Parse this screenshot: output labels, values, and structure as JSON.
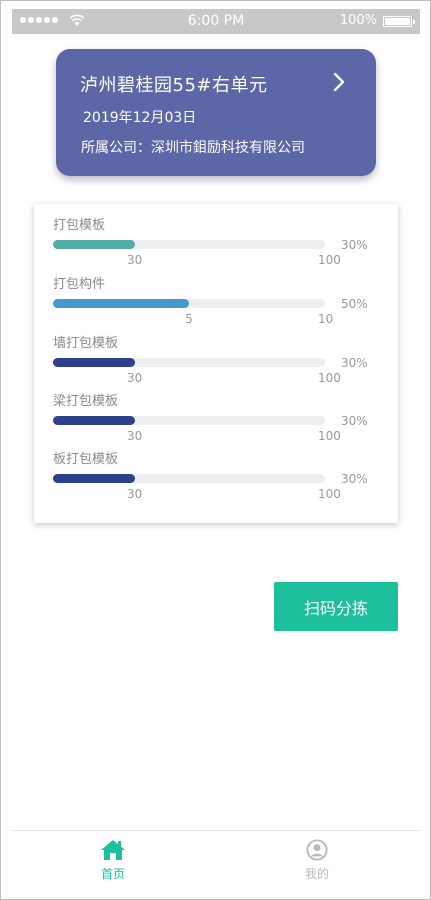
{
  "status_bar": {
    "time": "6:00 PM",
    "battery_percent": "100%"
  },
  "project": {
    "title": "泸州碧桂园55#右单元",
    "date": "2019年12月03日",
    "company": "所属公司：深圳市鉬励科技有限公司"
  },
  "progress_items": [
    {
      "label": "打包模板",
      "percent_text": "30%",
      "current": "30",
      "max": "100",
      "fraction": 0.3,
      "color": "#52ada8"
    },
    {
      "label": "打包构件",
      "percent_text": "50%",
      "current": "5",
      "max": "10",
      "fraction": 0.5,
      "color": "#4499cf"
    },
    {
      "label": "墙打包模板",
      "percent_text": "30%",
      "current": "30",
      "max": "100",
      "fraction": 0.3,
      "color": "#2e3f8c"
    },
    {
      "label": "梁打包模板",
      "percent_text": "30%",
      "current": "30",
      "max": "100",
      "fraction": 0.3,
      "color": "#2e3f8c"
    },
    {
      "label": "板打包模板",
      "percent_text": "30%",
      "current": "30",
      "max": "100",
      "fraction": 0.3,
      "color": "#2e3f8c"
    }
  ],
  "actions": {
    "scan_label": "扫码分拣"
  },
  "tabs": [
    {
      "label": "首页",
      "icon": "home-icon",
      "active": true
    },
    {
      "label": "我的",
      "icon": "user-icon",
      "active": false
    }
  ],
  "colors": {
    "accent": "#1ebf9d",
    "card": "#5d67a8"
  }
}
